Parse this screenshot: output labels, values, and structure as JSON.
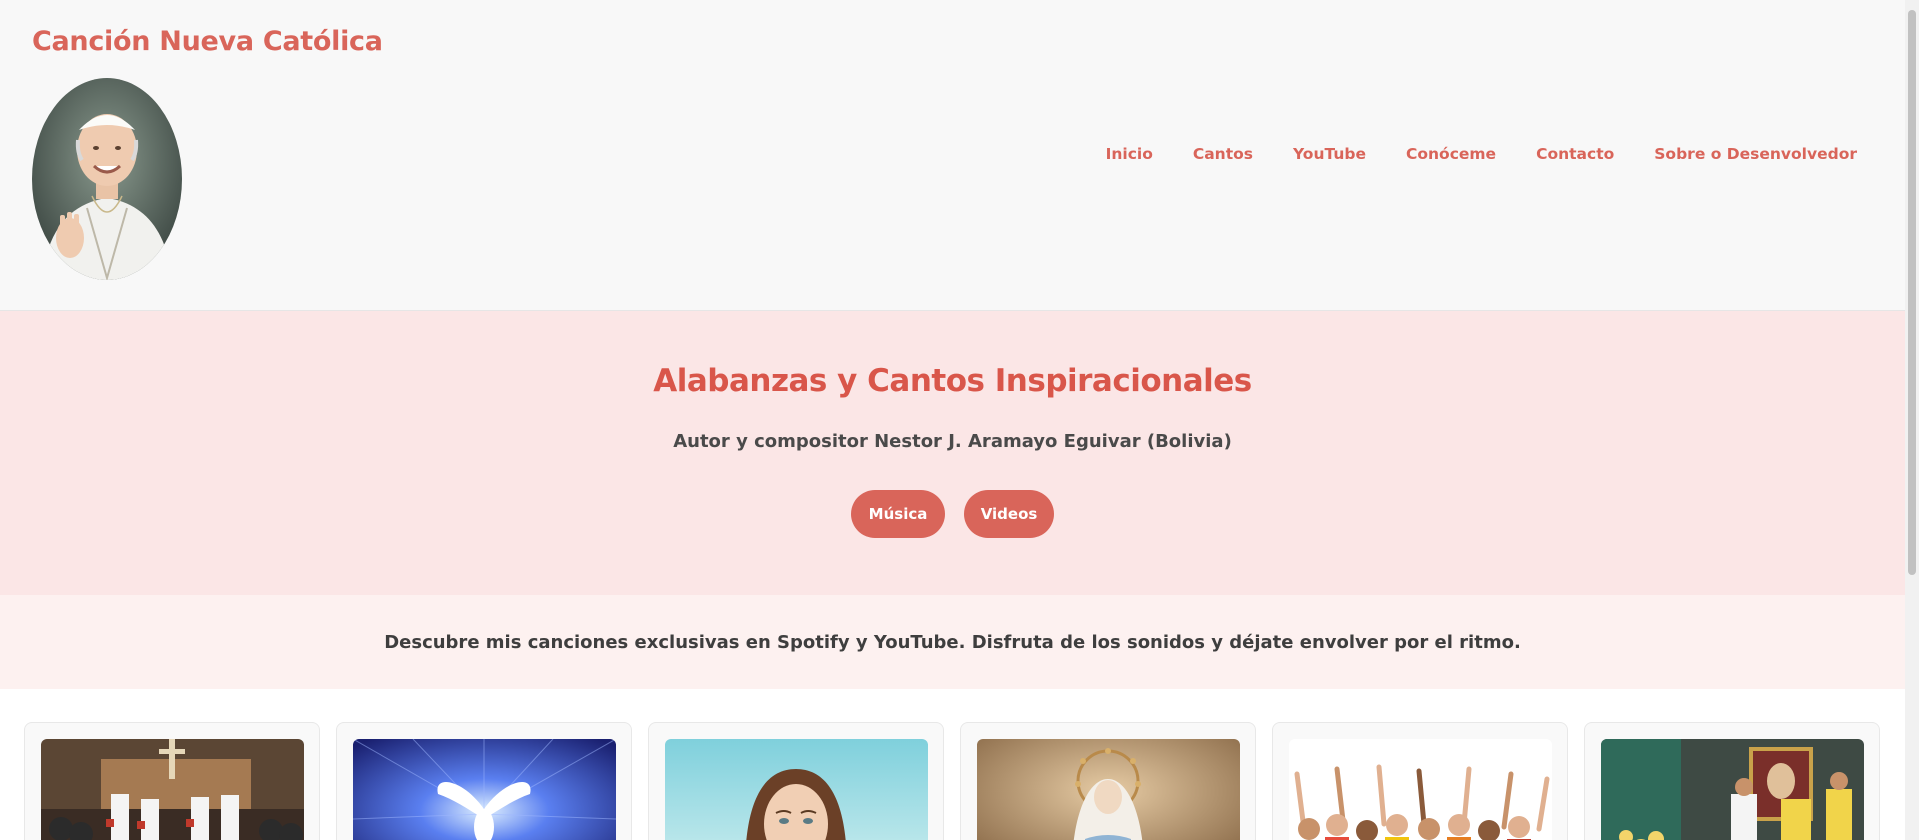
{
  "header": {
    "site_title": "Canción Nueva Católica",
    "avatar_icon": "portrait-icon",
    "nav": [
      "Inicio",
      "Cantos",
      "YouTube",
      "Conóceme",
      "Contacto",
      "Sobre o Desenvolvedor"
    ]
  },
  "hero": {
    "title": "Alabanzas y Cantos Inspiracionales",
    "subtitle": "Autor y compositor Nestor J. Aramayo Eguivar (Bolivia)",
    "buttons": [
      "Música",
      "Videos"
    ]
  },
  "intro": {
    "text": "Descubre mis canciones exclusivas en Spotify y YouTube. Disfruta de los sonidos y déjate envolver por el ritmo."
  },
  "cards": [
    {
      "image_icon": "church-choir-image"
    },
    {
      "image_icon": "dove-image"
    },
    {
      "image_icon": "virgin-mary-portrait-image"
    },
    {
      "image_icon": "virgin-mary-statue-image"
    },
    {
      "image_icon": "crowd-celebration-image"
    },
    {
      "image_icon": "church-ceremony-image"
    }
  ],
  "colors": {
    "accent": "#d9655a",
    "hero_bg": "#fbe6e6",
    "intro_bg": "#fdf1f0",
    "header_bg": "#f8f8f8"
  }
}
